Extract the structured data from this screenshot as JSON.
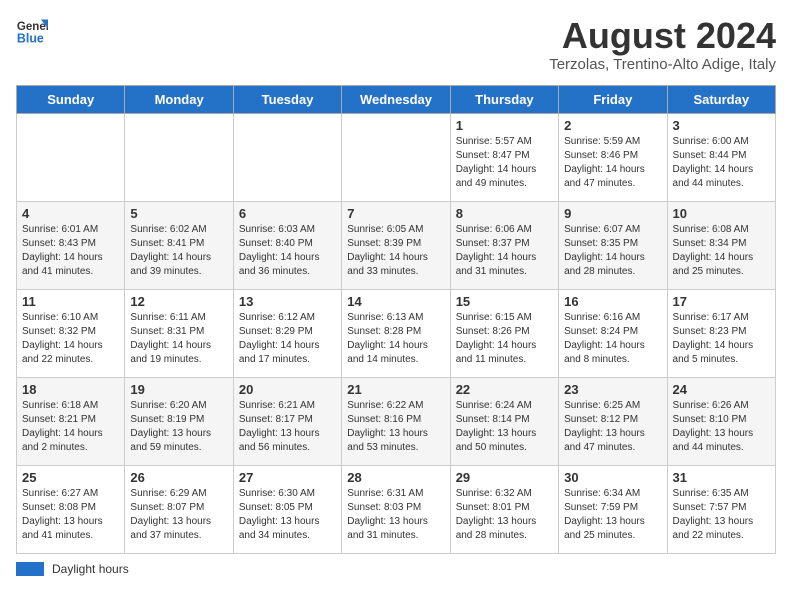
{
  "header": {
    "logo_line1": "General",
    "logo_line2": "Blue",
    "title": "August 2024",
    "subtitle": "Terzolas, Trentino-Alto Adige, Italy"
  },
  "weekdays": [
    "Sunday",
    "Monday",
    "Tuesday",
    "Wednesday",
    "Thursday",
    "Friday",
    "Saturday"
  ],
  "weeks": [
    [
      {
        "day": "",
        "info": ""
      },
      {
        "day": "",
        "info": ""
      },
      {
        "day": "",
        "info": ""
      },
      {
        "day": "",
        "info": ""
      },
      {
        "day": "1",
        "info": "Sunrise: 5:57 AM\nSunset: 8:47 PM\nDaylight: 14 hours\nand 49 minutes."
      },
      {
        "day": "2",
        "info": "Sunrise: 5:59 AM\nSunset: 8:46 PM\nDaylight: 14 hours\nand 47 minutes."
      },
      {
        "day": "3",
        "info": "Sunrise: 6:00 AM\nSunset: 8:44 PM\nDaylight: 14 hours\nand 44 minutes."
      }
    ],
    [
      {
        "day": "4",
        "info": "Sunrise: 6:01 AM\nSunset: 8:43 PM\nDaylight: 14 hours\nand 41 minutes."
      },
      {
        "day": "5",
        "info": "Sunrise: 6:02 AM\nSunset: 8:41 PM\nDaylight: 14 hours\nand 39 minutes."
      },
      {
        "day": "6",
        "info": "Sunrise: 6:03 AM\nSunset: 8:40 PM\nDaylight: 14 hours\nand 36 minutes."
      },
      {
        "day": "7",
        "info": "Sunrise: 6:05 AM\nSunset: 8:39 PM\nDaylight: 14 hours\nand 33 minutes."
      },
      {
        "day": "8",
        "info": "Sunrise: 6:06 AM\nSunset: 8:37 PM\nDaylight: 14 hours\nand 31 minutes."
      },
      {
        "day": "9",
        "info": "Sunrise: 6:07 AM\nSunset: 8:35 PM\nDaylight: 14 hours\nand 28 minutes."
      },
      {
        "day": "10",
        "info": "Sunrise: 6:08 AM\nSunset: 8:34 PM\nDaylight: 14 hours\nand 25 minutes."
      }
    ],
    [
      {
        "day": "11",
        "info": "Sunrise: 6:10 AM\nSunset: 8:32 PM\nDaylight: 14 hours\nand 22 minutes."
      },
      {
        "day": "12",
        "info": "Sunrise: 6:11 AM\nSunset: 8:31 PM\nDaylight: 14 hours\nand 19 minutes."
      },
      {
        "day": "13",
        "info": "Sunrise: 6:12 AM\nSunset: 8:29 PM\nDaylight: 14 hours\nand 17 minutes."
      },
      {
        "day": "14",
        "info": "Sunrise: 6:13 AM\nSunset: 8:28 PM\nDaylight: 14 hours\nand 14 minutes."
      },
      {
        "day": "15",
        "info": "Sunrise: 6:15 AM\nSunset: 8:26 PM\nDaylight: 14 hours\nand 11 minutes."
      },
      {
        "day": "16",
        "info": "Sunrise: 6:16 AM\nSunset: 8:24 PM\nDaylight: 14 hours\nand 8 minutes."
      },
      {
        "day": "17",
        "info": "Sunrise: 6:17 AM\nSunset: 8:23 PM\nDaylight: 14 hours\nand 5 minutes."
      }
    ],
    [
      {
        "day": "18",
        "info": "Sunrise: 6:18 AM\nSunset: 8:21 PM\nDaylight: 14 hours\nand 2 minutes."
      },
      {
        "day": "19",
        "info": "Sunrise: 6:20 AM\nSunset: 8:19 PM\nDaylight: 13 hours\nand 59 minutes."
      },
      {
        "day": "20",
        "info": "Sunrise: 6:21 AM\nSunset: 8:17 PM\nDaylight: 13 hours\nand 56 minutes."
      },
      {
        "day": "21",
        "info": "Sunrise: 6:22 AM\nSunset: 8:16 PM\nDaylight: 13 hours\nand 53 minutes."
      },
      {
        "day": "22",
        "info": "Sunrise: 6:24 AM\nSunset: 8:14 PM\nDaylight: 13 hours\nand 50 minutes."
      },
      {
        "day": "23",
        "info": "Sunrise: 6:25 AM\nSunset: 8:12 PM\nDaylight: 13 hours\nand 47 minutes."
      },
      {
        "day": "24",
        "info": "Sunrise: 6:26 AM\nSunset: 8:10 PM\nDaylight: 13 hours\nand 44 minutes."
      }
    ],
    [
      {
        "day": "25",
        "info": "Sunrise: 6:27 AM\nSunset: 8:08 PM\nDaylight: 13 hours\nand 41 minutes."
      },
      {
        "day": "26",
        "info": "Sunrise: 6:29 AM\nSunset: 8:07 PM\nDaylight: 13 hours\nand 37 minutes."
      },
      {
        "day": "27",
        "info": "Sunrise: 6:30 AM\nSunset: 8:05 PM\nDaylight: 13 hours\nand 34 minutes."
      },
      {
        "day": "28",
        "info": "Sunrise: 6:31 AM\nSunset: 8:03 PM\nDaylight: 13 hours\nand 31 minutes."
      },
      {
        "day": "29",
        "info": "Sunrise: 6:32 AM\nSunset: 8:01 PM\nDaylight: 13 hours\nand 28 minutes."
      },
      {
        "day": "30",
        "info": "Sunrise: 6:34 AM\nSunset: 7:59 PM\nDaylight: 13 hours\nand 25 minutes."
      },
      {
        "day": "31",
        "info": "Sunrise: 6:35 AM\nSunset: 7:57 PM\nDaylight: 13 hours\nand 22 minutes."
      }
    ]
  ],
  "legend": {
    "box_label": "Daylight hours"
  }
}
